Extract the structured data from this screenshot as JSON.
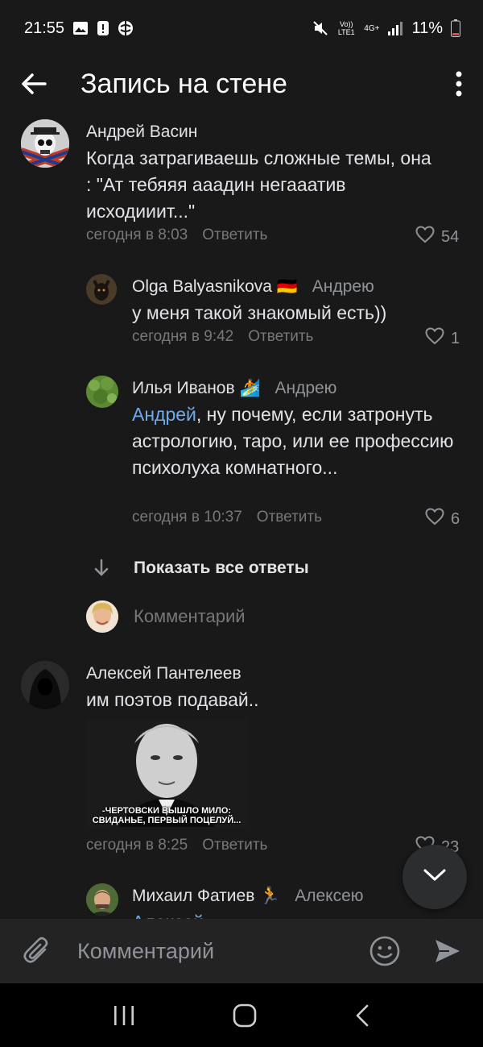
{
  "status_bar": {
    "time": "21:55",
    "battery": "11%",
    "network_label_1": "Vo)) LTE1",
    "network_label_2": "4G+"
  },
  "header": {
    "title": "Запись на стене"
  },
  "comments": [
    {
      "author": "Андрей Васин",
      "reply_to": "",
      "text": "Когда затрагиваешь сложные темы, она : \"Ат тебяяя ааадин негааатив исходииит...\"",
      "time": "сегодня в 8:03",
      "reply_label": "Ответить",
      "likes": "54"
    },
    {
      "author": "Olga Balyasnikova",
      "author_emoji": "🇩🇪",
      "reply_to": "Андрею",
      "text": "у меня такой знакомый есть))",
      "time": "сегодня в 9:42",
      "reply_label": "Ответить",
      "likes": "1"
    },
    {
      "author": "Илья Иванов",
      "author_emoji": "🏄",
      "reply_to": "Андрею",
      "mention": "Андрей",
      "text": ", ну почему, если затронуть астрологию, таро, или ее профессию психолуха комнатного...",
      "time": "сегодня в 10:37",
      "reply_label": "Ответить",
      "likes": "6"
    },
    {
      "author": "Алексей Пантелеев",
      "reply_to": "",
      "text": "им поэтов подавай..",
      "image_caption": "-ЧЕРТОВСКИ ВЫШЛО МИЛО: СВИДАНЬЕ, ПЕРВЫЙ ПОЦЕЛУЙ...",
      "time": "сегодня в 8:25",
      "reply_label": "Ответить",
      "likes": "23"
    },
    {
      "author": "Михаил Фатиев",
      "author_emoji": "🏃",
      "reply_to": "Алексею",
      "mention": "Алексей"
    }
  ],
  "show_all_replies": "Показать все ответы",
  "inline_comment_placeholder": "Комментарий",
  "composer": {
    "placeholder": "Комментарий"
  },
  "colors": {
    "background": "#19191a",
    "accent": "#71aaeb",
    "secondary_text": "#76787a"
  }
}
